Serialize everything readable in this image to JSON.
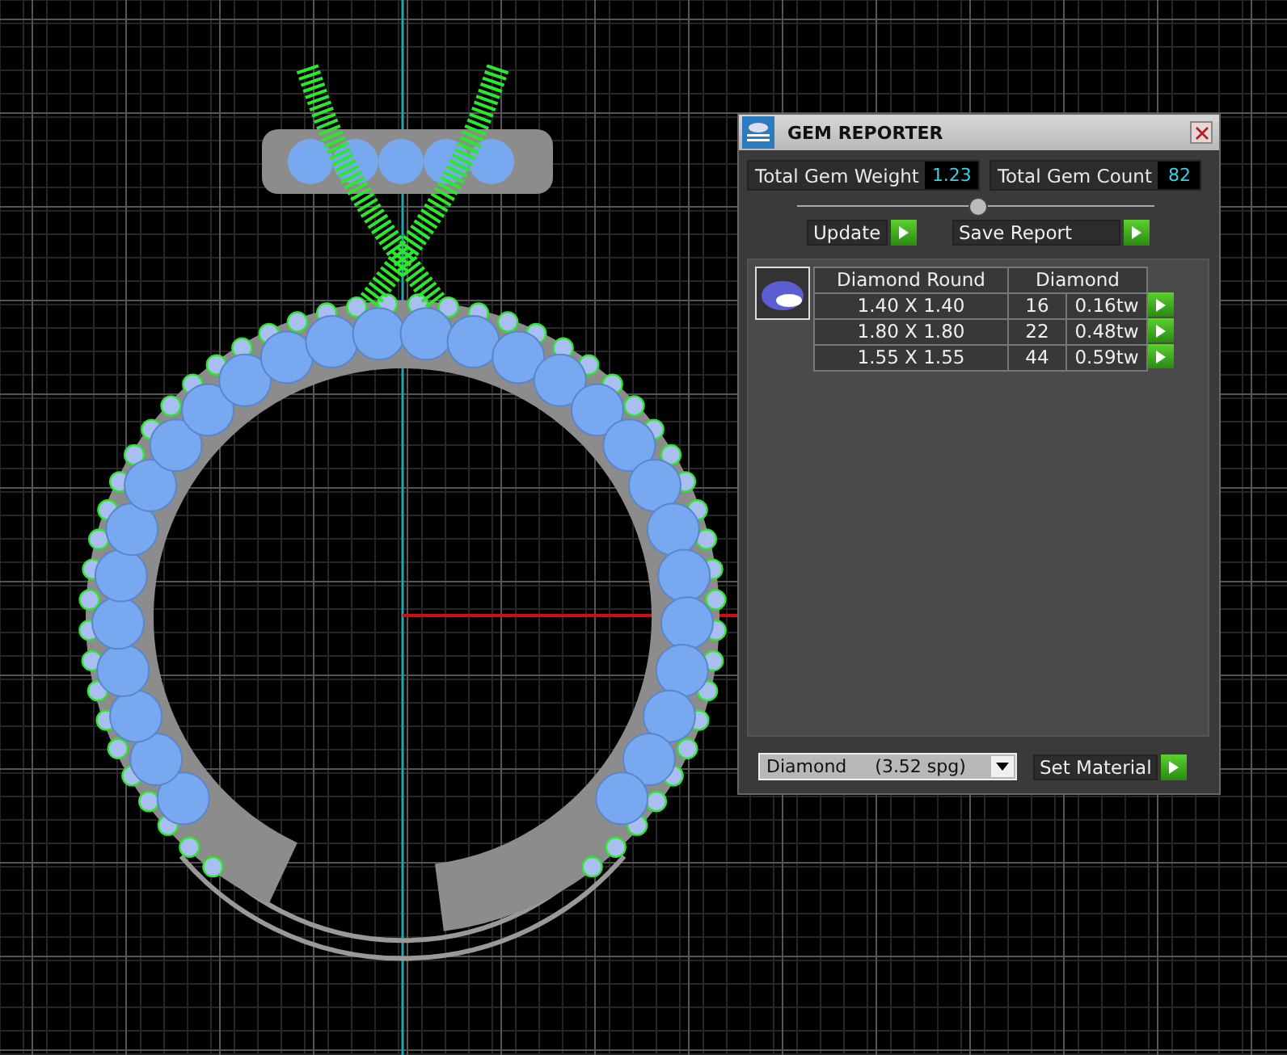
{
  "panel": {
    "title": "GEM REPORTER"
  },
  "totals": [
    {
      "label": "Total Gem Weight",
      "value": "1.23"
    },
    {
      "label": "Total Gem Count",
      "value": "82"
    }
  ],
  "actions": [
    {
      "label": "Update"
    },
    {
      "label": "Save Report"
    }
  ],
  "table": {
    "columns": [
      "Diamond Round",
      "Diamond"
    ],
    "rows": [
      {
        "size": "1.40 X 1.40",
        "count": "16",
        "weight": "0.16tw"
      },
      {
        "size": "1.80 X 1.80",
        "count": "22",
        "weight": "0.48tw"
      },
      {
        "size": "1.55 X 1.55",
        "count": "44",
        "weight": "0.59tw"
      }
    ]
  },
  "material": {
    "value": "Diamond     (3.52 spg)",
    "button": "Set Material"
  }
}
